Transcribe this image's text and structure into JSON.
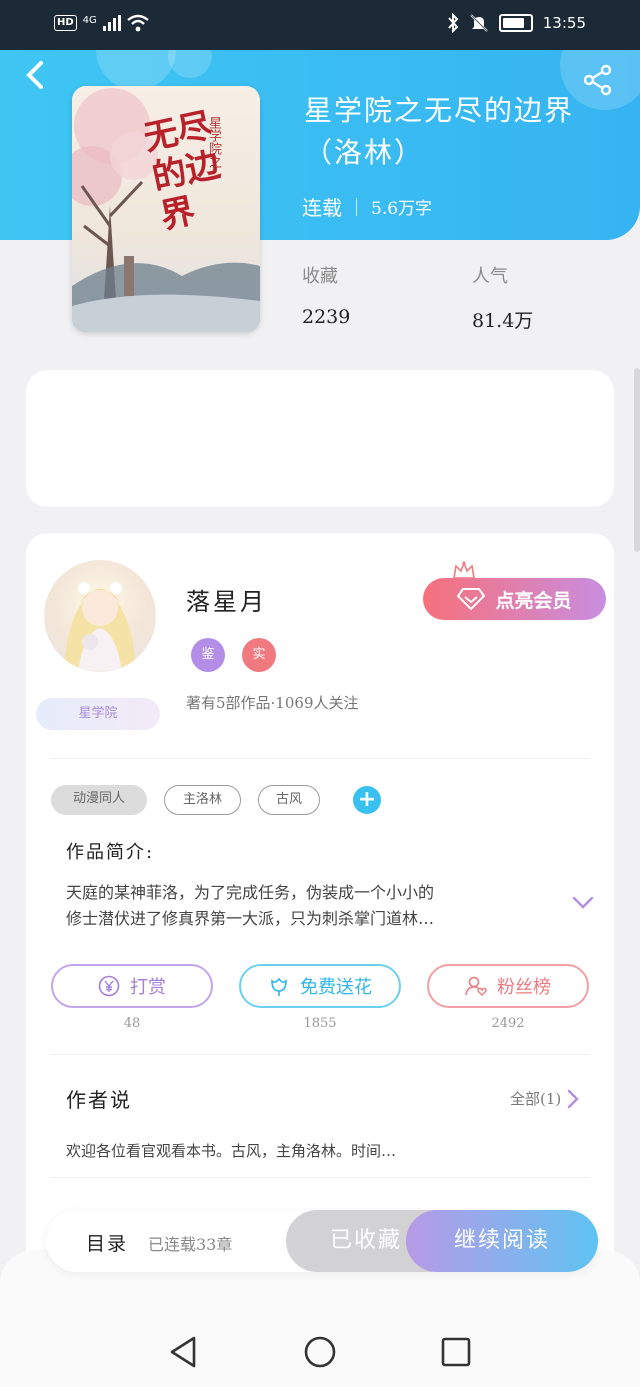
{
  "status": {
    "network": "4G",
    "hd": "HD",
    "time": "13:55",
    "battery_level": 0.85
  },
  "book": {
    "title": "星学院之无尽的边界（洛林）",
    "status": "连载",
    "word_count": "5.6万字",
    "cover_text": "无尽的边界",
    "cover_subtitle": "星学院之"
  },
  "stats": {
    "collect_label": "收藏",
    "collect_value": "2239",
    "popularity_label": "人气",
    "popularity_value": "81.4万"
  },
  "author": {
    "name": "落星月",
    "badge_1": "鉴",
    "badge_2": "实",
    "works_info": "著有5部作品·1069人关注",
    "school_label": "星学院"
  },
  "vip": {
    "label": "点亮会员"
  },
  "tags": [
    "动漫同人",
    "主洛林",
    "古风"
  ],
  "intro": {
    "title": "作品简介:",
    "text_line_1": "天庭的某神菲洛，为了完成任务，伪装成一个小小的",
    "text_line_2": "修士潜伏进了修真界第一大派，只为刺杀掌门道林…"
  },
  "actions": {
    "reward": {
      "label": "打赏",
      "count": "48"
    },
    "flower": {
      "label": "免费送花",
      "count": "1855"
    },
    "fans": {
      "label": "粉丝榜",
      "count": "2492"
    }
  },
  "author_say": {
    "title": "作者说",
    "all_label": "全部(1)",
    "text": "欢迎各位看官观看本书。古风，主角洛林。时间…"
  },
  "bottom": {
    "catalog_label": "目录",
    "chapters_label": "已连载33章",
    "collected_label": "已收藏",
    "read_label": "继续阅读"
  },
  "colors": {
    "primary": "#3fc6f3",
    "vip_start": "#f7707a",
    "vip_end": "#c88ee0",
    "reward": "#b48ee6",
    "flower": "#3fc6f3",
    "fans": "#f08080"
  }
}
